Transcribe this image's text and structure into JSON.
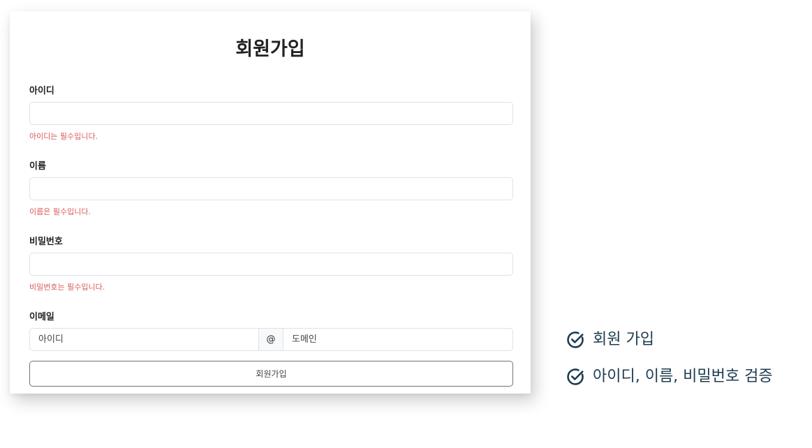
{
  "form": {
    "title": "회원가입",
    "fields": [
      {
        "label": "아이디",
        "value": "",
        "error": "아이디는 필수입니다."
      },
      {
        "label": "이름",
        "value": "",
        "error": "이름은 필수입니다."
      },
      {
        "label": "비밀번호",
        "value": "",
        "error": "비밀번호는 필수입니다."
      }
    ],
    "email": {
      "label": "이메일",
      "id_placeholder": "아이디",
      "at": "@",
      "domain_placeholder": "도메인"
    },
    "submit_label": "회원가입"
  },
  "features": [
    {
      "icon": "check-circle-icon",
      "text": "회원 가입"
    },
    {
      "icon": "check-circle-icon",
      "text": "아이디, 이름, 비밀번호 검증"
    }
  ],
  "colors": {
    "error": "#dc5a5a",
    "feature_text": "#1c3b4f",
    "check_icon": "#1c3b4f"
  }
}
